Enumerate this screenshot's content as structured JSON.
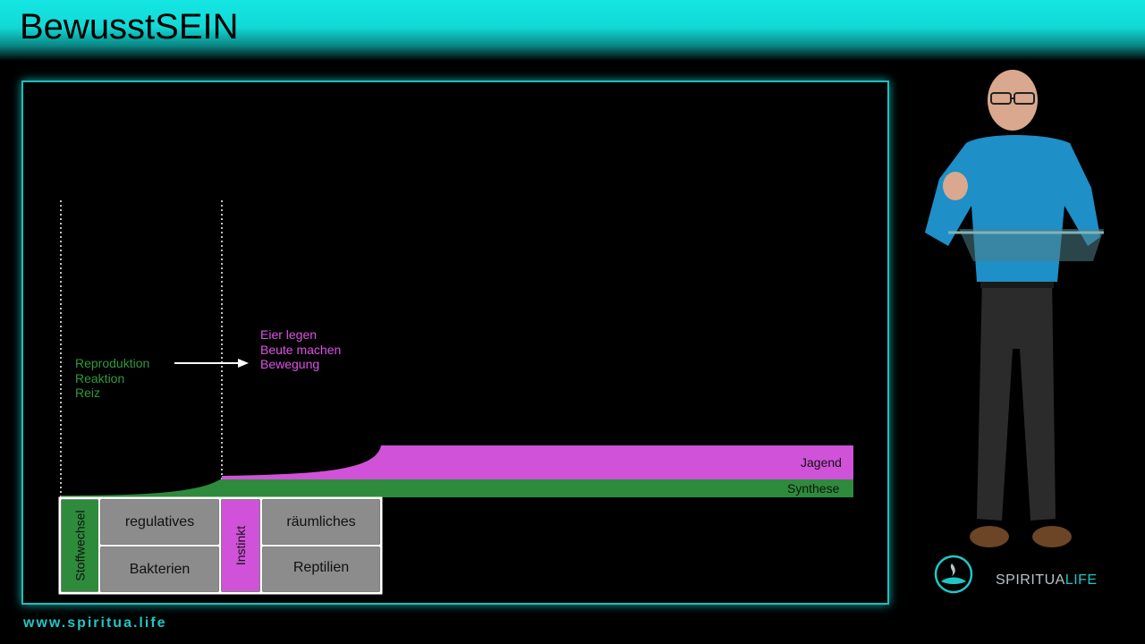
{
  "header": {
    "title": "BewusstSEIN"
  },
  "diagram": {
    "stage1_traits": [
      "Reproduktion",
      "Reaktion",
      "Reiz"
    ],
    "stage2_traits": [
      "Eier legen",
      "Beute machen",
      "Bewegung"
    ],
    "bands": {
      "top": "Jagend",
      "bottom": "Synthese"
    },
    "level1": {
      "label": "Stoffwechsel",
      "cells": [
        "regulatives",
        "Bakterien"
      ]
    },
    "level2": {
      "label": "Instinkt",
      "cells": [
        "räumliches",
        "Reptilien"
      ]
    },
    "colors": {
      "green": "#2e8b3c",
      "magenta": "#d052d8",
      "cell": "#8c8c8c",
      "accent": "#1fc7c4"
    }
  },
  "footer": {
    "url": "www.spiritua.life"
  },
  "logo": {
    "text_prefix": "SPIRITUA",
    "text_suffix": "LIFE"
  }
}
